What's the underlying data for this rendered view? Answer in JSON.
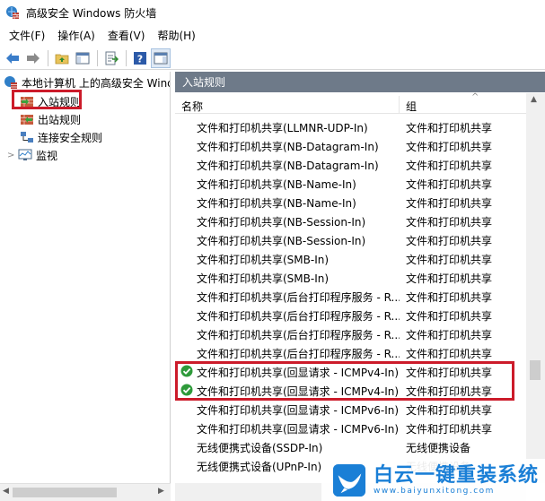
{
  "window": {
    "title": "高级安全 Windows 防火墙"
  },
  "menu": [
    "文件(F)",
    "操作(A)",
    "查看(V)",
    "帮助(H)"
  ],
  "toolbar": {
    "icons": [
      "back-arrow-icon",
      "forward-arrow-icon",
      "up-folder-icon",
      "show-hide-tree-icon",
      "export-list-icon",
      "help-icon",
      "show-hide-action-icon"
    ]
  },
  "tree": {
    "root": "本地计算机 上的高级安全 Windows 防火墙",
    "items": [
      {
        "label": "入站规则",
        "icon": "inbound-rules-icon",
        "selected": true
      },
      {
        "label": "出站规则",
        "icon": "outbound-rules-icon",
        "selected": false
      },
      {
        "label": "连接安全规则",
        "icon": "connection-security-icon",
        "selected": false
      },
      {
        "label": "监视",
        "icon": "monitor-icon",
        "selected": false
      }
    ]
  },
  "main": {
    "header": "入站规则",
    "columns": {
      "name": "名称",
      "group": "组"
    },
    "rows": [
      {
        "name": "文件和打印机共享(LLMNR-UDP-In)",
        "group": "文件和打印机共享",
        "enabled": false
      },
      {
        "name": "文件和打印机共享(NB-Datagram-In)",
        "group": "文件和打印机共享",
        "enabled": false
      },
      {
        "name": "文件和打印机共享(NB-Datagram-In)",
        "group": "文件和打印机共享",
        "enabled": false
      },
      {
        "name": "文件和打印机共享(NB-Name-In)",
        "group": "文件和打印机共享",
        "enabled": false
      },
      {
        "name": "文件和打印机共享(NB-Name-In)",
        "group": "文件和打印机共享",
        "enabled": false
      },
      {
        "name": "文件和打印机共享(NB-Session-In)",
        "group": "文件和打印机共享",
        "enabled": false
      },
      {
        "name": "文件和打印机共享(NB-Session-In)",
        "group": "文件和打印机共享",
        "enabled": false
      },
      {
        "name": "文件和打印机共享(SMB-In)",
        "group": "文件和打印机共享",
        "enabled": false
      },
      {
        "name": "文件和打印机共享(SMB-In)",
        "group": "文件和打印机共享",
        "enabled": false
      },
      {
        "name": "文件和打印机共享(后台打印程序服务 - R...",
        "group": "文件和打印机共享",
        "enabled": false
      },
      {
        "name": "文件和打印机共享(后台打印程序服务 - R...",
        "group": "文件和打印机共享",
        "enabled": false
      },
      {
        "name": "文件和打印机共享(后台打印程序服务 - R...",
        "group": "文件和打印机共享",
        "enabled": false
      },
      {
        "name": "文件和打印机共享(后台打印程序服务 - R...",
        "group": "文件和打印机共享",
        "enabled": false
      },
      {
        "name": "文件和打印机共享(回显请求 - ICMPv4-In)",
        "group": "文件和打印机共享",
        "enabled": true
      },
      {
        "name": "文件和打印机共享(回显请求 - ICMPv4-In)",
        "group": "文件和打印机共享",
        "enabled": true
      },
      {
        "name": "文件和打印机共享(回显请求 - ICMPv6-In)",
        "group": "文件和打印机共享",
        "enabled": false
      },
      {
        "name": "文件和打印机共享(回显请求 - ICMPv6-In)",
        "group": "文件和打印机共享",
        "enabled": false
      },
      {
        "name": "无线便携式设备(SSDP-In)",
        "group": "无线便携设备",
        "enabled": false
      },
      {
        "name": "无线便携式设备(UPnP-In)",
        "group": "无线便携设备",
        "enabled": false
      }
    ]
  },
  "watermark": {
    "name": "白云一键重装系统",
    "url": "www.baiyunxitong.com"
  },
  "colors": {
    "header_bg": "#6e7a89",
    "highlight": "#cc1b2a",
    "enabled_check": "#2e9a3a",
    "brand": "#1a7fd6"
  }
}
